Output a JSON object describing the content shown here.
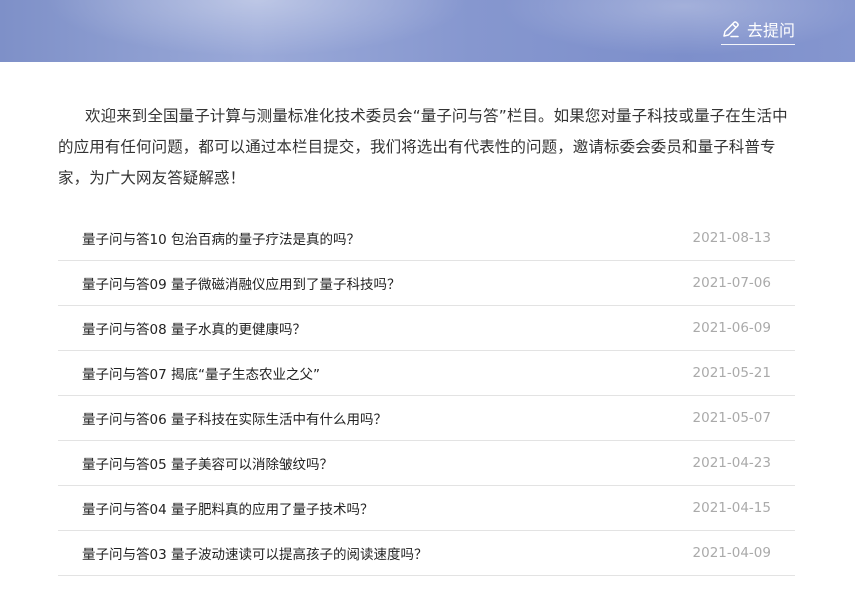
{
  "header": {
    "ask_label": "去提问",
    "ask_icon": "pencil-icon"
  },
  "intro": {
    "text": "欢迎来到全国量子计算与测量标准化技术委员会“量子问与答”栏目。如果您对量子科技或量子在生活中的应用有任何问题，都可以通过本栏目提交，我们将选出有代表性的问题，邀请标委会委员和量子科普专家，为广大网友答疑解惑！"
  },
  "qa_list": [
    {
      "title": "量子问与答10 包治百病的量子疗法是真的吗？",
      "date": "2021-08-13"
    },
    {
      "title": "量子问与答09 量子微磁消融仪应用到了量子科技吗？",
      "date": "2021-07-06"
    },
    {
      "title": "量子问与答08 量子水真的更健康吗？",
      "date": "2021-06-09"
    },
    {
      "title": "量子问与答07 揭底“量子生态农业之父”",
      "date": "2021-05-21"
    },
    {
      "title": "量子问与答06 量子科技在实际生活中有什么用吗？",
      "date": "2021-05-07"
    },
    {
      "title": "量子问与答05 量子美容可以消除皱纹吗？",
      "date": "2021-04-23"
    },
    {
      "title": "量子问与答04 量子肥料真的应用了量子技术吗？",
      "date": "2021-04-15"
    },
    {
      "title": "量子问与答03 量子波动速读可以提高孩子的阅读速度吗？",
      "date": "2021-04-09"
    }
  ]
}
